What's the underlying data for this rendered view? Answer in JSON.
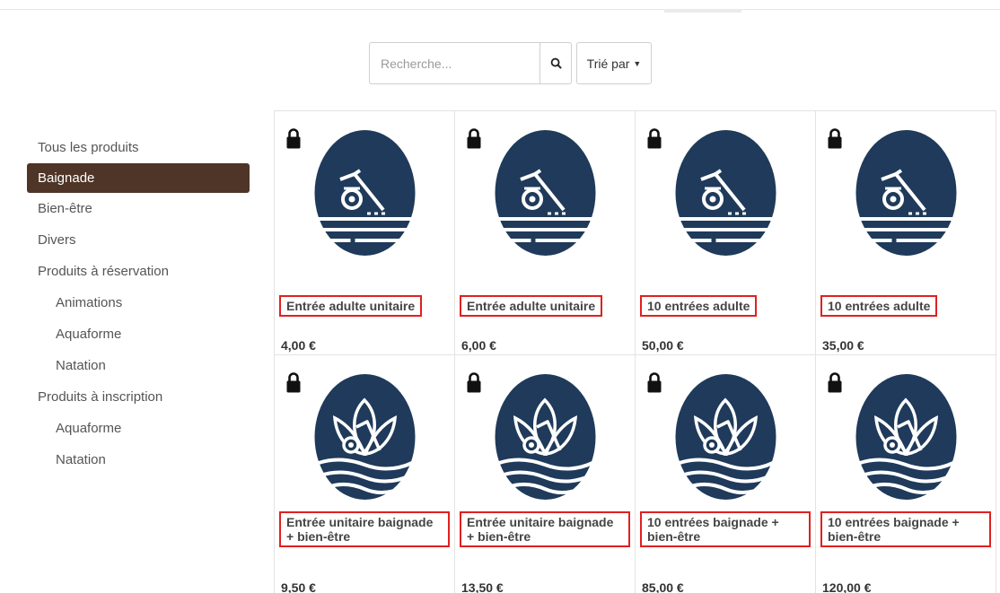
{
  "search": {
    "placeholder": "Recherche...",
    "sort_label": "Trié par"
  },
  "categories": [
    {
      "label": "Tous les produits"
    },
    {
      "label": "Baignade"
    },
    {
      "label": "Bien-être"
    },
    {
      "label": "Divers"
    },
    {
      "label": "Produits à réservation"
    },
    {
      "label": "Animations"
    },
    {
      "label": "Aquaforme"
    },
    {
      "label": "Natation"
    },
    {
      "label": "Produits à inscription"
    },
    {
      "label": "Aquaforme"
    },
    {
      "label": "Natation"
    }
  ],
  "active_category": "Baignade",
  "products": [
    {
      "title": "Entrée adulte unitaire",
      "price": "4,00 €",
      "icon": "swimmer-icon"
    },
    {
      "title": "Entrée adulte unitaire",
      "price": "6,00 €",
      "icon": "swimmer-icon"
    },
    {
      "title": "10 entrées adulte",
      "price": "50,00 €",
      "icon": "swimmer-icon"
    },
    {
      "title": "10 entrées adulte",
      "price": "35,00 €",
      "icon": "swimmer-icon"
    },
    {
      "title": "Entrée unitaire baignade + bien-être",
      "price": "9,50 €",
      "icon": "lotus-swimmer-icon"
    },
    {
      "title": "Entrée unitaire baignade + bien-être",
      "price": "13,50 €",
      "icon": "lotus-swimmer-icon"
    },
    {
      "title": "10 entrées baignade + bien-être",
      "price": "85,00 €",
      "icon": "lotus-swimmer-icon"
    },
    {
      "title": "10 entrées baignade + bien-être",
      "price": "120,00 €",
      "icon": "lotus-swimmer-icon"
    }
  ],
  "colors": {
    "active_bg": "#4e3527",
    "icon_blue": "#1f3a5a",
    "highlight": "#e02020"
  }
}
